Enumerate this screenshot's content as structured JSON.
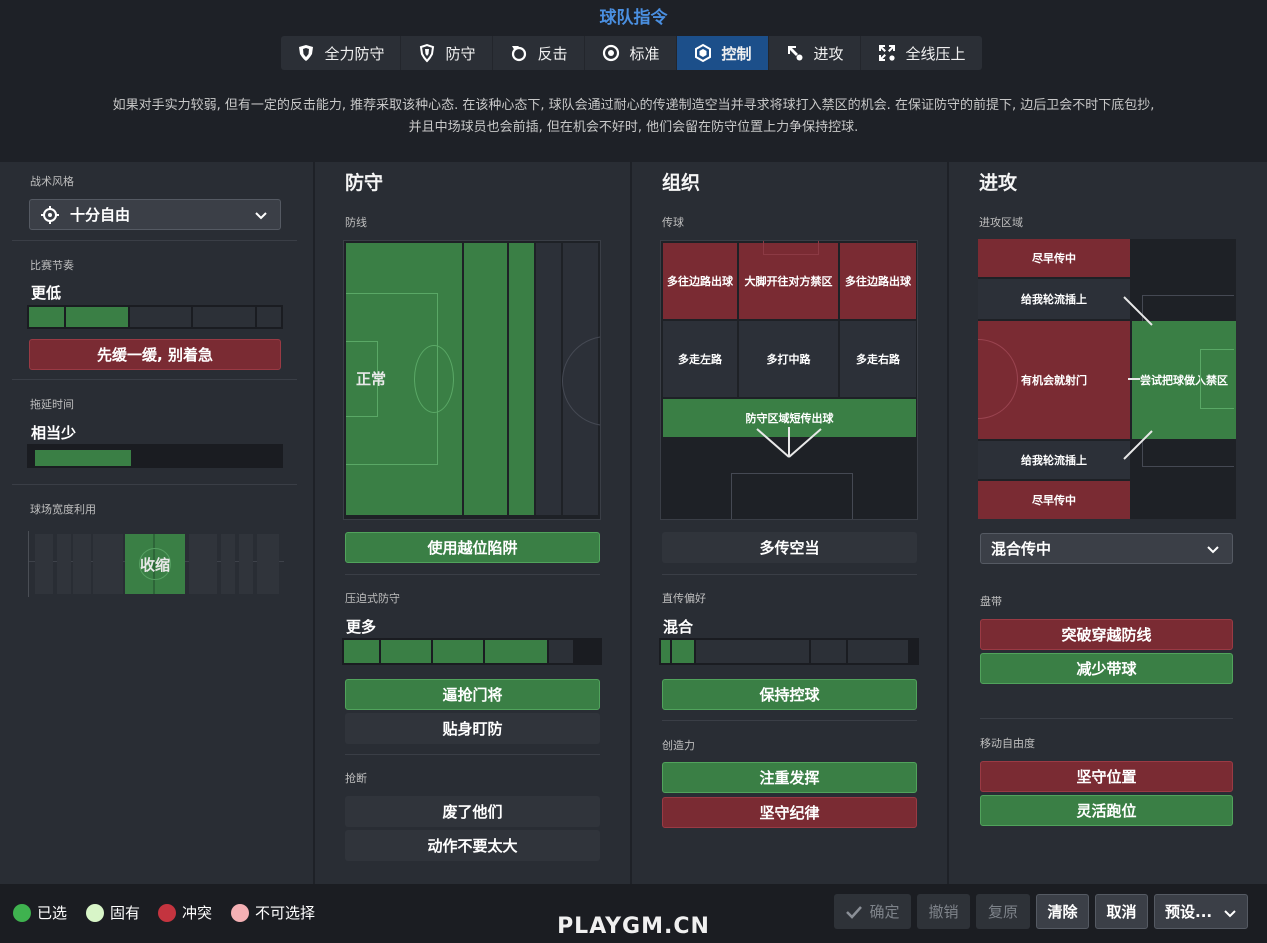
{
  "header": {
    "title": "球队指令"
  },
  "mentality": [
    {
      "label": "全力防守",
      "icon": "double-shield-icon",
      "active": false
    },
    {
      "label": "防守",
      "icon": "shield-icon",
      "active": false
    },
    {
      "label": "反击",
      "icon": "counter-arrow-icon",
      "active": false
    },
    {
      "label": "标准",
      "icon": "balance-icon",
      "active": false
    },
    {
      "label": "控制",
      "icon": "control-cube-icon",
      "active": true
    },
    {
      "label": "进攻",
      "icon": "attack-arrow-icon",
      "active": false
    },
    {
      "label": "全线压上",
      "icon": "all-out-attack-icon",
      "active": false
    }
  ],
  "description": {
    "line1": "如果对手实力较弱, 但有一定的反击能力, 推荐采取该种心态. 在该种心态下, 球队会通过耐心的传递制造空当并寻求将球打入禁区的机会. 在保证防守的前提下, 边后卫会不时下底包抄,",
    "line2": "并且中场球员也会前插, 但在机会不好时, 他们会留在防守位置上力争保持控球."
  },
  "left": {
    "style_label": "战术风格",
    "style_value": "十分自由",
    "tempo_label": "比赛节奏",
    "tempo_value": "更低",
    "tempo_level": 2,
    "tempo_button": "先缓一缓, 别着急",
    "timewasting_label": "拖延时间",
    "timewasting_value": "相当少",
    "timewasting_level": 0.5,
    "width_label": "球场宽度利用",
    "width_value": "收缩"
  },
  "defence": {
    "title": "防守",
    "line_label": "防线",
    "line_value": "正常",
    "offside_button": "使用越位陷阱",
    "press_label": "压迫式防守",
    "press_value": "更多",
    "press_level": 4,
    "press_buttons": [
      "逼抢门将",
      "贴身盯防"
    ],
    "tackle_label": "抢断",
    "tackle_buttons": [
      "废了他们",
      "动作不要太大"
    ]
  },
  "organisation": {
    "title": "组织",
    "passing_label": "传球",
    "zones": {
      "wide_left": "多往边路出球",
      "long": "大脚开往对方禁区",
      "wide_right": "多往边路出球",
      "left": "多走左路",
      "center": "多打中路",
      "right": "多走右路",
      "short": "防守区域短传出球"
    },
    "space_button": "多传空当",
    "directness_label": "直传偏好",
    "directness_value": "混合",
    "directness_level": 2,
    "possession_button": "保持控球",
    "creativity_label": "创造力",
    "creativity_buttons": [
      "注重发挥",
      "坚守纪律"
    ]
  },
  "attack": {
    "title": "进攻",
    "zone_label": "进攻区域",
    "zones": {
      "early_top": "尽早传中",
      "overlap_top": "给我轮流插上",
      "shoot": "有机会就射门",
      "work_into_box": "尝试把球做入禁区",
      "overlap_bottom": "给我轮流插上",
      "early_bottom": "尽早传中"
    },
    "cross_value": "混合传中",
    "dribble_label": "盘带",
    "dribble_buttons": [
      "突破穿越防线",
      "减少带球"
    ],
    "freedom_label": "移动自由度",
    "freedom_buttons": [
      "坚守位置",
      "灵活跑位"
    ]
  },
  "legend": [
    {
      "label": "已选",
      "color": "#3fb24f"
    },
    {
      "label": "固有",
      "color": "#d8f5c8"
    },
    {
      "label": "冲突",
      "color": "#c4343f"
    },
    {
      "label": "不可选择",
      "color": "#f4b0b4"
    }
  ],
  "footer": {
    "confirm": "确定",
    "undo": "撤销",
    "redo": "复原",
    "clear": "清除",
    "cancel": "取消",
    "presets": "预设..."
  },
  "watermark": "PLAYGM.CN"
}
